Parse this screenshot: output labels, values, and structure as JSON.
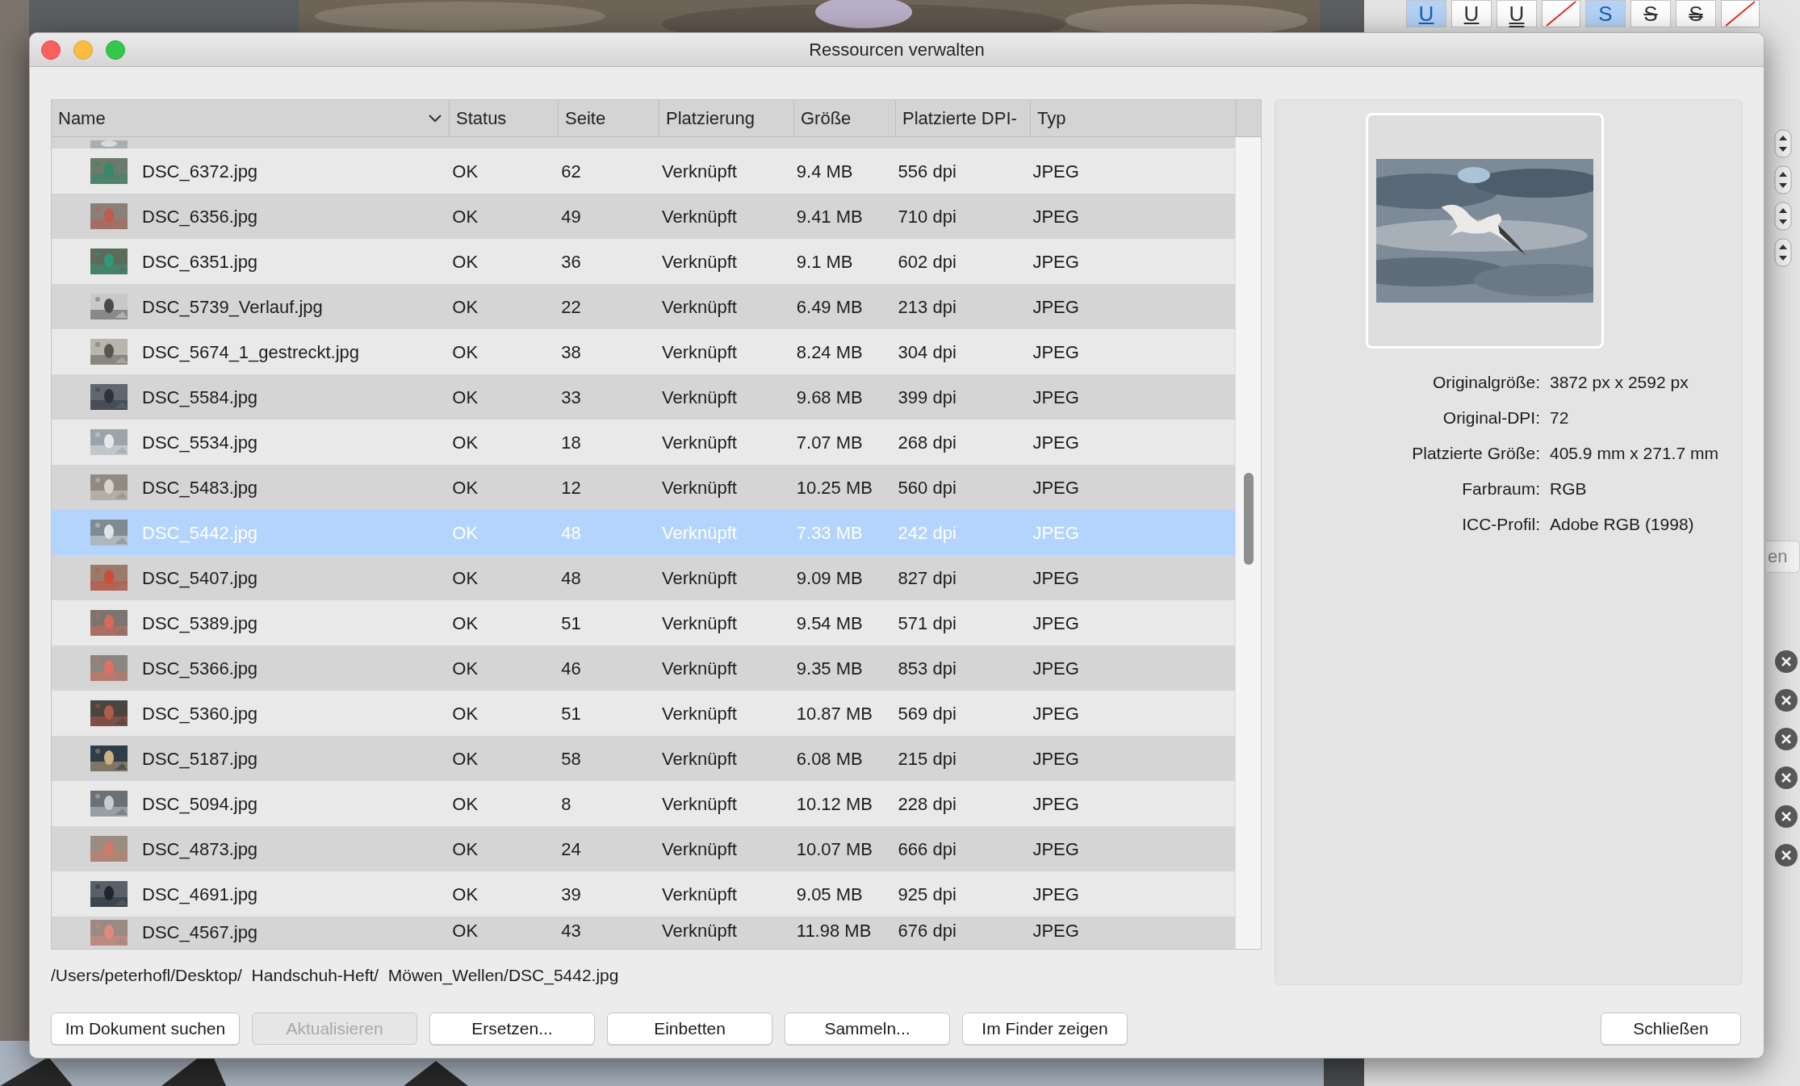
{
  "window": {
    "title": "Ressourcen verwalten"
  },
  "background_toolbar": [
    {
      "label": "U",
      "kind": "underline",
      "selected": true
    },
    {
      "label": "U",
      "kind": "underline",
      "selected": false
    },
    {
      "label": "U",
      "kind": "double",
      "selected": false
    },
    {
      "kind": "none",
      "selected": false
    },
    {
      "label": "S",
      "kind": "plain",
      "selected": true
    },
    {
      "label": "S",
      "kind": "strike",
      "selected": false
    },
    {
      "label": "S",
      "kind": "double-strike",
      "selected": false
    },
    {
      "kind": "none",
      "selected": false
    }
  ],
  "background_button": {
    "label": "en"
  },
  "table": {
    "columns": [
      {
        "label": "Name",
        "sortable": true
      },
      {
        "label": "Status"
      },
      {
        "label": "Seite"
      },
      {
        "label": "Platzierung"
      },
      {
        "label": "Größe"
      },
      {
        "label": "Platzierte DPI-"
      },
      {
        "label": "Typ"
      }
    ],
    "rows": [
      {
        "name": "DSC_6372.jpg",
        "status": "OK",
        "page": "62",
        "placement": "Verknüpft",
        "size": "9.4 MB",
        "dpi": "556 dpi",
        "type": "JPEG",
        "selected": false
      },
      {
        "name": "DSC_6356.jpg",
        "status": "OK",
        "page": "49",
        "placement": "Verknüpft",
        "size": "9.41 MB",
        "dpi": "710 dpi",
        "type": "JPEG",
        "selected": false
      },
      {
        "name": "DSC_6351.jpg",
        "status": "OK",
        "page": "36",
        "placement": "Verknüpft",
        "size": "9.1 MB",
        "dpi": "602 dpi",
        "type": "JPEG",
        "selected": false
      },
      {
        "name": "DSC_5739_Verlauf.jpg",
        "status": "OK",
        "page": "22",
        "placement": "Verknüpft",
        "size": "6.49 MB",
        "dpi": "213 dpi",
        "type": "JPEG",
        "selected": false
      },
      {
        "name": "DSC_5674_1_gestreckt.jpg",
        "status": "OK",
        "page": "38",
        "placement": "Verknüpft",
        "size": "8.24 MB",
        "dpi": "304 dpi",
        "type": "JPEG",
        "selected": false
      },
      {
        "name": "DSC_5584.jpg",
        "status": "OK",
        "page": "33",
        "placement": "Verknüpft",
        "size": "9.68 MB",
        "dpi": "399 dpi",
        "type": "JPEG",
        "selected": false
      },
      {
        "name": "DSC_5534.jpg",
        "status": "OK",
        "page": "18",
        "placement": "Verknüpft",
        "size": "7.07 MB",
        "dpi": "268 dpi",
        "type": "JPEG",
        "selected": false
      },
      {
        "name": "DSC_5483.jpg",
        "status": "OK",
        "page": "12",
        "placement": "Verknüpft",
        "size": "10.25 MB",
        "dpi": "560 dpi",
        "type": "JPEG",
        "selected": false
      },
      {
        "name": "DSC_5442.jpg",
        "status": "OK",
        "page": "48",
        "placement": "Verknüpft",
        "size": "7.33 MB",
        "dpi": "242 dpi",
        "type": "JPEG",
        "selected": true
      },
      {
        "name": "DSC_5407.jpg",
        "status": "OK",
        "page": "48",
        "placement": "Verknüpft",
        "size": "9.09 MB",
        "dpi": "827 dpi",
        "type": "JPEG",
        "selected": false
      },
      {
        "name": "DSC_5389.jpg",
        "status": "OK",
        "page": "51",
        "placement": "Verknüpft",
        "size": "9.54 MB",
        "dpi": "571 dpi",
        "type": "JPEG",
        "selected": false
      },
      {
        "name": "DSC_5366.jpg",
        "status": "OK",
        "page": "46",
        "placement": "Verknüpft",
        "size": "9.35 MB",
        "dpi": "853 dpi",
        "type": "JPEG",
        "selected": false
      },
      {
        "name": "DSC_5360.jpg",
        "status": "OK",
        "page": "51",
        "placement": "Verknüpft",
        "size": "10.87 MB",
        "dpi": "569 dpi",
        "type": "JPEG",
        "selected": false
      },
      {
        "name": "DSC_5187.jpg",
        "status": "OK",
        "page": "58",
        "placement": "Verknüpft",
        "size": "6.08 MB",
        "dpi": "215 dpi",
        "type": "JPEG",
        "selected": false
      },
      {
        "name": "DSC_5094.jpg",
        "status": "OK",
        "page": "8",
        "placement": "Verknüpft",
        "size": "10.12 MB",
        "dpi": "228 dpi",
        "type": "JPEG",
        "selected": false
      },
      {
        "name": "DSC_4873.jpg",
        "status": "OK",
        "page": "24",
        "placement": "Verknüpft",
        "size": "10.07 MB",
        "dpi": "666 dpi",
        "type": "JPEG",
        "selected": false
      },
      {
        "name": "DSC_4691.jpg",
        "status": "OK",
        "page": "39",
        "placement": "Verknüpft",
        "size": "9.05 MB",
        "dpi": "925 dpi",
        "type": "JPEG",
        "selected": false
      },
      {
        "name": "DSC_4567.jpg",
        "status": "OK",
        "page": "43",
        "placement": "Verknüpft",
        "size": "11.98 MB",
        "dpi": "676 dpi",
        "type": "JPEG",
        "selected": false
      }
    ]
  },
  "path": "/Users/peterhofl/Desktop/  Handschuh-Heft/  Möwen_Wellen/DSC_5442.jpg",
  "details": [
    {
      "label": "Originalgröße:",
      "value": "3872 px x 2592 px"
    },
    {
      "label": "Original-DPI:",
      "value": "72"
    },
    {
      "label": "Platzierte Größe:",
      "value": "405.9 mm x 271.7 mm"
    },
    {
      "label": "Farbraum:",
      "value": "RGB"
    },
    {
      "label": "ICC-Profil:",
      "value": "Adobe RGB (1998)"
    }
  ],
  "buttons": [
    {
      "label": "Im Dokument suchen",
      "disabled": false
    },
    {
      "label": "Aktualisieren",
      "disabled": true
    },
    {
      "label": "Ersetzen...",
      "disabled": false
    },
    {
      "label": "Einbetten",
      "disabled": false
    },
    {
      "label": "Sammeln...",
      "disabled": false
    },
    {
      "label": "Im Finder zeigen",
      "disabled": false
    }
  ],
  "close_button": {
    "label": "Schließen"
  }
}
